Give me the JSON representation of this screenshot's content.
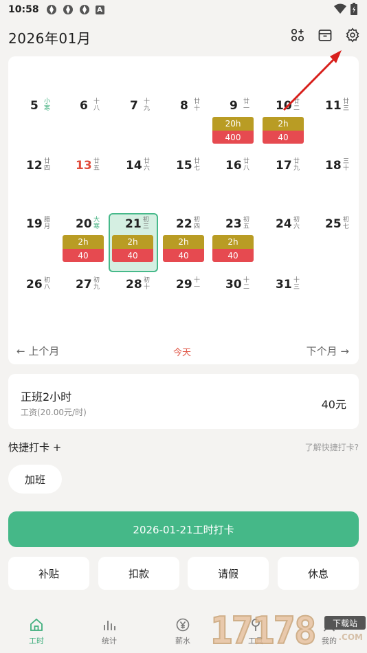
{
  "status_bar": {
    "time": "10:58",
    "keyboard_badge": "A"
  },
  "header": {
    "title": "2026年01月",
    "icons": [
      "apps-add-icon",
      "archive-icon",
      "settings-icon"
    ]
  },
  "calendar": {
    "rows": [
      [
        {
          "day": "5",
          "lunar": "小寒",
          "term": true
        },
        {
          "day": "6",
          "lunar": "十八"
        },
        {
          "day": "7",
          "lunar": "十九"
        },
        {
          "day": "8",
          "lunar": "廿十"
        },
        {
          "day": "9",
          "lunar": "廿一",
          "hours": "20h",
          "pay": "400"
        },
        {
          "day": "10",
          "lunar": "廿二",
          "hours": "2h",
          "pay": "40"
        },
        {
          "day": "11",
          "lunar": "廿三"
        }
      ],
      [
        {
          "day": "12",
          "lunar": "廿四"
        },
        {
          "day": "13",
          "lunar": "廿五",
          "red": true
        },
        {
          "day": "14",
          "lunar": "廿六"
        },
        {
          "day": "15",
          "lunar": "廿七"
        },
        {
          "day": "16",
          "lunar": "廿八"
        },
        {
          "day": "17",
          "lunar": "廿九"
        },
        {
          "day": "18",
          "lunar": "三十"
        }
      ],
      [
        {
          "day": "19",
          "lunar": "腊月"
        },
        {
          "day": "20",
          "lunar": "大寒",
          "term": true,
          "hours": "2h",
          "pay": "40"
        },
        {
          "day": "21",
          "lunar": "初三",
          "hours": "2h",
          "pay": "40",
          "selected": true
        },
        {
          "day": "22",
          "lunar": "初四",
          "hours": "2h",
          "pay": "40"
        },
        {
          "day": "23",
          "lunar": "初五",
          "hours": "2h",
          "pay": "40"
        },
        {
          "day": "24",
          "lunar": "初六"
        },
        {
          "day": "25",
          "lunar": "初七"
        }
      ],
      [
        {
          "day": "26",
          "lunar": "初八"
        },
        {
          "day": "27",
          "lunar": "初九"
        },
        {
          "day": "28",
          "lunar": "初十"
        },
        {
          "day": "29",
          "lunar": "十一"
        },
        {
          "day": "30",
          "lunar": "十二"
        },
        {
          "day": "31",
          "lunar": "十三"
        }
      ]
    ],
    "nav": {
      "prev": "← 上个月",
      "today": "今天",
      "next": "下个月 →"
    }
  },
  "summary": {
    "title": "正班2小时",
    "subtitle": "工资(20.00元/时)",
    "amount": "40元"
  },
  "quick": {
    "label": "快捷打卡 +",
    "help": "了解快捷打卡?",
    "chip": "加班"
  },
  "main_button": "2026-01-21工时打卡",
  "actions": [
    "补贴",
    "扣款",
    "请假",
    "休息"
  ],
  "bottom_nav": [
    {
      "label": "工时",
      "icon": "home-icon",
      "active": true
    },
    {
      "label": "统计",
      "icon": "bar-chart-icon"
    },
    {
      "label": "薪水",
      "icon": "yen-icon"
    },
    {
      "label": "工具",
      "icon": "tool-icon"
    },
    {
      "label": "我的",
      "icon": "user-icon"
    }
  ],
  "watermark": {
    "text": "17178",
    "badge": "下载站",
    "sub": ".COM"
  },
  "colors": {
    "accent": "#45b888",
    "hours_bg": "#b99c24",
    "pay_bg": "#e64a50",
    "holiday_red": "#e04a3a",
    "annotation": "#d8201c"
  }
}
